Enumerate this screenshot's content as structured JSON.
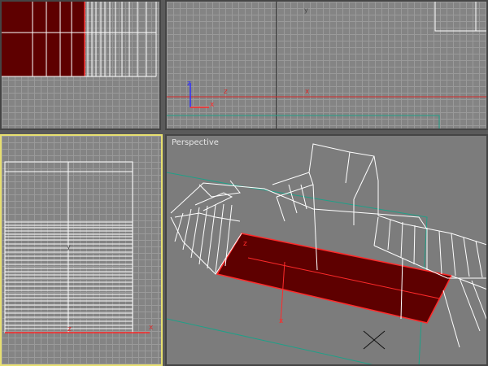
{
  "viewports": {
    "perspective": {
      "label": "Perspective"
    }
  },
  "axis_labels": {
    "x": "x",
    "y": "y",
    "z": "z"
  },
  "colors": {
    "selection_fill": "#5e0000",
    "selection_edge": "#ff2a2a",
    "wire": "#ffffff",
    "active_border": "#e8e070",
    "grid_bg": "#848484",
    "cyan_line": "#1fa088"
  }
}
